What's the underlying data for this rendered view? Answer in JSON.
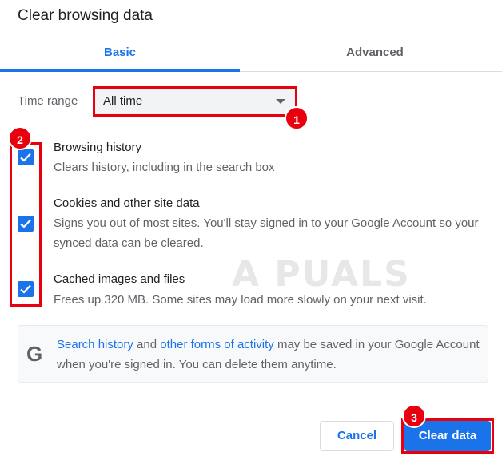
{
  "dialog": {
    "title": "Clear browsing data"
  },
  "tabs": [
    {
      "label": "Basic",
      "active": true
    },
    {
      "label": "Advanced",
      "active": false
    }
  ],
  "time_range": {
    "label": "Time range",
    "selected": "All time"
  },
  "items": [
    {
      "title": "Browsing history",
      "description": "Clears history, including in the search box",
      "checked": true
    },
    {
      "title": "Cookies and other site data",
      "description": "Signs you out of most sites. You'll stay signed in to your Google Account so your synced data can be cleared.",
      "checked": true
    },
    {
      "title": "Cached images and files",
      "description": "Frees up 320 MB. Some sites may load more slowly on your next visit.",
      "checked": true
    }
  ],
  "info": {
    "icon": "google-g-icon",
    "link1": "Search history",
    "text1": " and ",
    "link2": "other forms of activity",
    "text2": " may be saved in your Google Account when you're signed in. You can delete them anytime."
  },
  "buttons": {
    "cancel": "Cancel",
    "clear": "Clear data"
  },
  "annotations": {
    "badge1": "1",
    "badge2": "2",
    "badge3": "3"
  },
  "watermark": "A PUALS",
  "colors": {
    "accent": "#1a73e8",
    "annotation": "#e8000f"
  }
}
